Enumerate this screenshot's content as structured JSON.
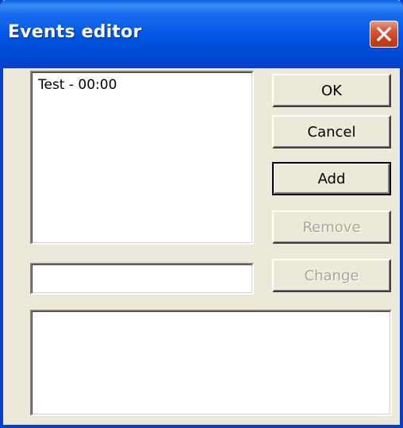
{
  "window": {
    "title": "Events editor",
    "close_icon": "close-icon"
  },
  "events_list": {
    "items": [
      {
        "label": "Test  -  00:00"
      }
    ]
  },
  "event_input": {
    "value": ""
  },
  "event_description": {
    "value": ""
  },
  "buttons": {
    "ok_label": "OK",
    "cancel_label": "Cancel",
    "add_label": "Add",
    "remove_label": "Remove",
    "change_label": "Change"
  },
  "colors": {
    "titlebar": "#0054e3",
    "dialog_face": "#ece9d8",
    "close_button": "#d7593a",
    "disabled_text": "#a8a69a"
  }
}
